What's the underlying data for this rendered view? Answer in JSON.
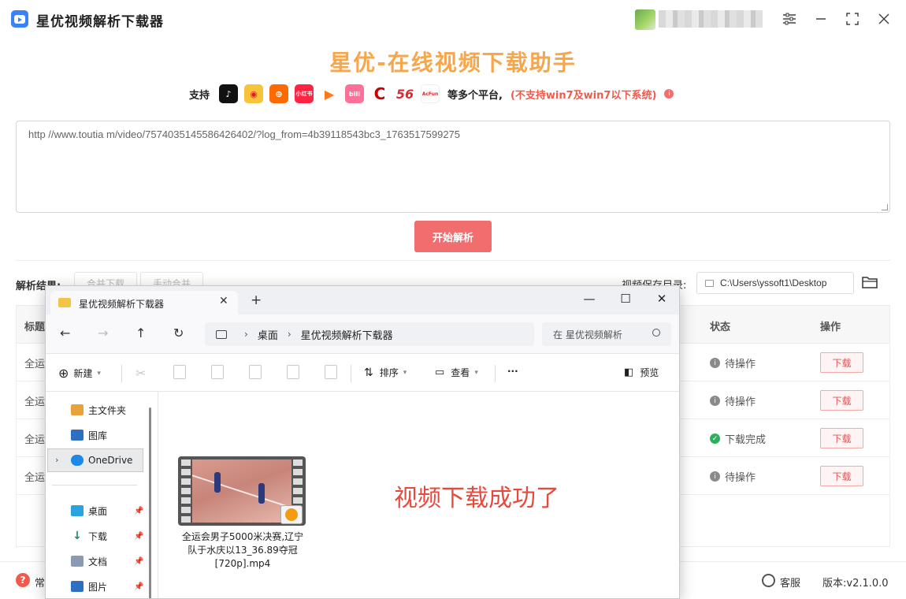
{
  "app": {
    "title": "星优视频解析下载器",
    "heading": "星优-在线视频下载助手"
  },
  "platforms": {
    "prefix": "支持",
    "items": [
      {
        "icon": "douyin-icon",
        "color": "#111111",
        "glyph": "♪"
      },
      {
        "icon": "weibo-icon",
        "color": "#f7c33b",
        "glyph": "◉"
      },
      {
        "icon": "kuaishou-icon",
        "color": "#ff6a00",
        "glyph": "⊕"
      },
      {
        "icon": "xiaohongshu-icon",
        "color": "#ff2442",
        "glyph": "小红书"
      },
      {
        "icon": "tencent-video-icon",
        "color": "#ffffff",
        "glyph": "▶"
      },
      {
        "icon": "bilibili-icon",
        "color": "#fb7299",
        "glyph": "bili"
      },
      {
        "icon": "cctv-icon",
        "color": "#ffffff",
        "glyph": "C"
      },
      {
        "icon": "56-icon",
        "color": "#ffffff",
        "glyph": "56"
      },
      {
        "icon": "acfun-icon",
        "color": "#ffffff",
        "glyph": "AcFun"
      }
    ],
    "suffix": "等多个平台,",
    "warning": "(不支持win7及win7以下系统)"
  },
  "url_input": {
    "value": "http   //www.toutia         m/video/7574035145586426402/?log_from=4b39118543bc3_1763517599275"
  },
  "start_button": "开始解析",
  "results": {
    "label": "解析结果:",
    "merge_all": "合并下载",
    "manual_merge": "手动合并",
    "save_dir_label": "视频保存目录:",
    "save_dir_value": "C:\\Users\\yssoft1\\Desktop"
  },
  "table": {
    "headers": {
      "title": "标题",
      "status": "状态",
      "action": "操作"
    },
    "rows": [
      {
        "title": "全运",
        "status": "待操作",
        "status_type": "pending",
        "action": "下载"
      },
      {
        "title": "全运",
        "status": "待操作",
        "status_type": "pending",
        "action": "下载"
      },
      {
        "title": "全运",
        "status": "下载完成",
        "status_type": "done",
        "action": "下载"
      },
      {
        "title": "全运",
        "status": "待操作",
        "status_type": "pending",
        "action": "下载"
      }
    ]
  },
  "footer": {
    "help": "常",
    "service": "客服",
    "version": "版本:v2.1.0.0"
  },
  "explorer": {
    "tab_title": "星优视频解析下载器",
    "breadcrumb": [
      "桌面",
      "星优视频解析下载器"
    ],
    "search_placeholder": "在 星优视频解析",
    "toolbar": {
      "new": "新建",
      "sort": "排序",
      "view": "查看",
      "more": "···",
      "preview": "预览"
    },
    "nav": [
      {
        "label": "主文件夹",
        "icon": "home-icon"
      },
      {
        "label": "图库",
        "icon": "gallery-icon"
      },
      {
        "label": "OneDrive",
        "icon": "onedrive-icon"
      },
      {
        "label": "桌面",
        "icon": "desktop-icon",
        "pinned": true
      },
      {
        "label": "下载",
        "icon": "download-icon",
        "pinned": true
      },
      {
        "label": "文档",
        "icon": "documents-icon",
        "pinned": true
      },
      {
        "label": "图片",
        "icon": "pictures-icon",
        "pinned": true
      }
    ],
    "file": {
      "name_line1": "全运会男子5000米决赛,辽宁",
      "name_line2": "队于水庆以13_36.89夺冠",
      "name_line3": "[720p].mp4"
    },
    "overlay_text": "视频下载成功了"
  },
  "colors": {
    "accent": "#f26e6e",
    "heading": "#f6a64b",
    "warning": "#f05a4d",
    "success": "#2eaf5b",
    "pending": "#8a8a8a"
  }
}
